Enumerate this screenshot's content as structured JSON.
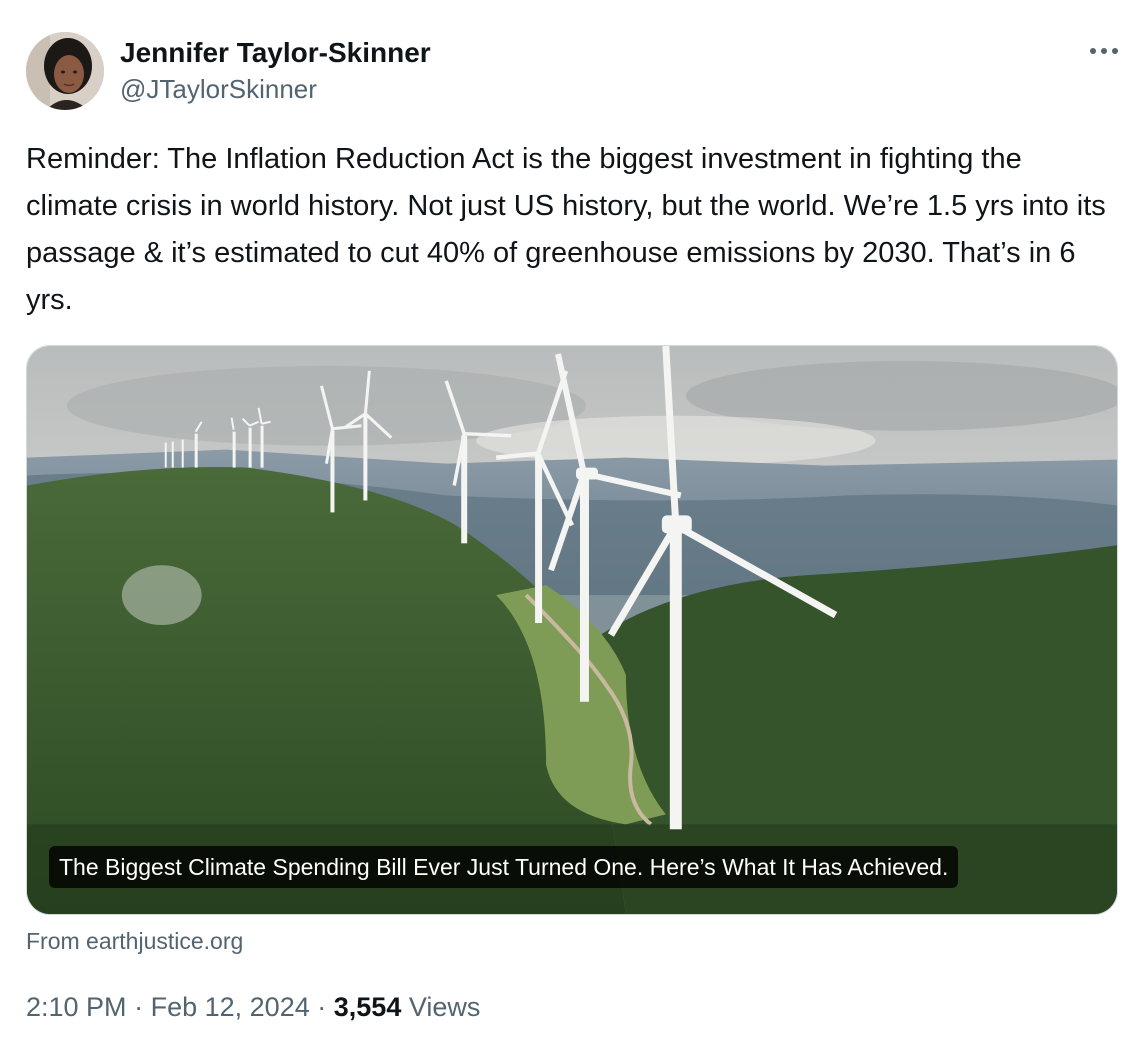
{
  "author": {
    "display_name": "Jennifer Taylor-Skinner",
    "handle": "@JTaylorSkinner",
    "avatar_icon": "user-avatar"
  },
  "more_icon": "more-horizontal-icon",
  "tweet": {
    "text": "Reminder: The Inflation Reduction Act is the biggest investment in fighting the climate crisis in world history. Not just US history, but the world. We’re 1.5 yrs into its passage & it’s estimated to cut 40% of greenhouse emissions by 2030. That’s in 6 yrs."
  },
  "card": {
    "caption": "The Biggest Climate Spending Bill Ever Just Turned One. Here’s What It Has Achieved.",
    "source": "From earthjustice.org"
  },
  "meta": {
    "time": "2:10 PM",
    "separator": "·",
    "date": "Feb 12, 2024",
    "views_count": "3,554",
    "views_label": "Views"
  },
  "colors": {
    "text_primary": "#0f1419",
    "text_secondary": "#536471",
    "border": "#cfd9de"
  }
}
